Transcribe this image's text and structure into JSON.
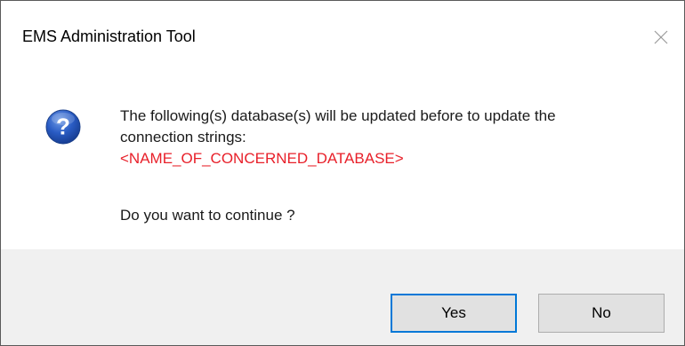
{
  "window": {
    "title": "EMS Administration Tool",
    "close_icon": "close-icon"
  },
  "message": {
    "icon": "question-icon",
    "line1": "The following(s) database(s) will be updated before to update the",
    "line2": "connection strings:",
    "database_name": "<NAME_OF_CONCERNED_DATABASE>",
    "question": "Do you want to continue ?"
  },
  "buttons": {
    "yes_label": "Yes",
    "no_label": "No"
  },
  "colors": {
    "database_name": "#e8202a",
    "default_button_border": "#0078d7",
    "footer_background": "#f0f0f0"
  }
}
